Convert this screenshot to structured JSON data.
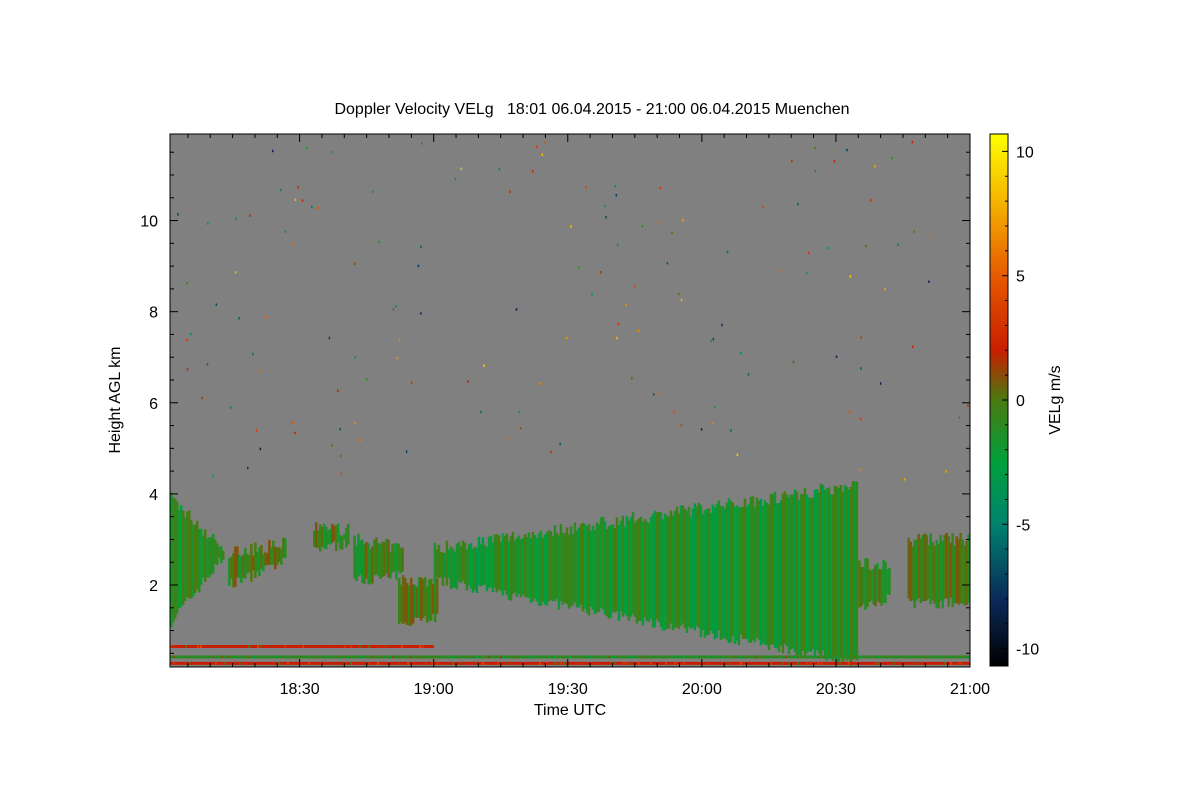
{
  "chart_data": {
    "type": "heatmap",
    "title": "Doppler Velocity VELg   18:01 06.04.2015 - 21:00 06.04.2015 Muenchen",
    "xlabel": "Time UTC",
    "ylabel": "Height AGL km",
    "xlim": [
      "18:01",
      "21:00"
    ],
    "ylim": [
      0.2,
      11.9
    ],
    "x_ticks": [
      "18:30",
      "19:00",
      "19:30",
      "20:00",
      "20:30",
      "21:00"
    ],
    "y_ticks": [
      2,
      4,
      6,
      8,
      10
    ],
    "grid": false,
    "background_color": "#808080",
    "colorbar": {
      "label": "VELg m/s",
      "range": [
        -10.7,
        10.7
      ],
      "ticks": [
        -10,
        -5,
        0,
        5,
        10
      ],
      "stops": [
        {
          "value": -10.7,
          "color": "#000000"
        },
        {
          "value": -8,
          "color": "#0a2a5a"
        },
        {
          "value": -5,
          "color": "#00826e"
        },
        {
          "value": -2.5,
          "color": "#00a03c"
        },
        {
          "value": 0,
          "color": "#4a7a10"
        },
        {
          "value": 2,
          "color": "#c81e00"
        },
        {
          "value": 5,
          "color": "#e65a00"
        },
        {
          "value": 8,
          "color": "#f5b400"
        },
        {
          "value": 10.7,
          "color": "#ffff00"
        }
      ]
    },
    "features": [
      {
        "name": "cloud-west",
        "x_range": [
          "18:01",
          "18:14"
        ],
        "base_km": [
          1.2,
          2.7
        ],
        "top_km": [
          3.9,
          2.7
        ],
        "velocity": -1.2
      },
      {
        "name": "cloud-1820",
        "x_range": [
          "18:14",
          "18:27"
        ],
        "base_km": [
          2.0,
          2.5
        ],
        "top_km": [
          2.7,
          2.9
        ],
        "velocity": -0.3
      },
      {
        "name": "cloud-1835",
        "x_range": [
          "18:33",
          "18:41"
        ],
        "base_km": [
          2.8,
          2.9
        ],
        "top_km": [
          3.3,
          3.2
        ],
        "velocity": -0.5
      },
      {
        "name": "cloud-1845",
        "x_range": [
          "18:42",
          "18:53"
        ],
        "base_km": [
          2.1,
          2.2
        ],
        "top_km": [
          3.0,
          2.8
        ],
        "velocity": -0.8
      },
      {
        "name": "cloud-1855",
        "x_range": [
          "18:52",
          "19:01"
        ],
        "base_km": [
          1.2,
          1.3
        ],
        "top_km": [
          2.1,
          2.1
        ],
        "velocity": -0.5
      },
      {
        "name": "cloud-main",
        "x_range": [
          "19:00",
          "20:35"
        ],
        "base_km": [
          2.1,
          0.3
        ],
        "top_km": [
          2.8,
          4.2
        ],
        "velocity": -1.5
      },
      {
        "name": "cloud-2037",
        "x_range": [
          "20:35",
          "20:42"
        ],
        "base_km": [
          1.5,
          1.7
        ],
        "top_km": [
          2.5,
          2.4
        ],
        "velocity": -0.8
      },
      {
        "name": "cloud-east",
        "x_range": [
          "20:46",
          "21:00"
        ],
        "base_km": [
          1.6,
          1.6
        ],
        "top_km": [
          3.0,
          3.0
        ],
        "velocity": -0.3
      },
      {
        "name": "clutter-line-upper",
        "x_range": [
          "18:01",
          "19:00"
        ],
        "height_km": 0.65,
        "velocity": 2.0
      },
      {
        "name": "clutter-line-mid",
        "x_range": [
          "18:01",
          "21:00"
        ],
        "height_km": 0.42,
        "velocity": -1.0
      },
      {
        "name": "clutter-line-lower",
        "x_range": [
          "18:01",
          "21:00"
        ],
        "height_km": 0.28,
        "velocity": 2.0
      }
    ]
  }
}
